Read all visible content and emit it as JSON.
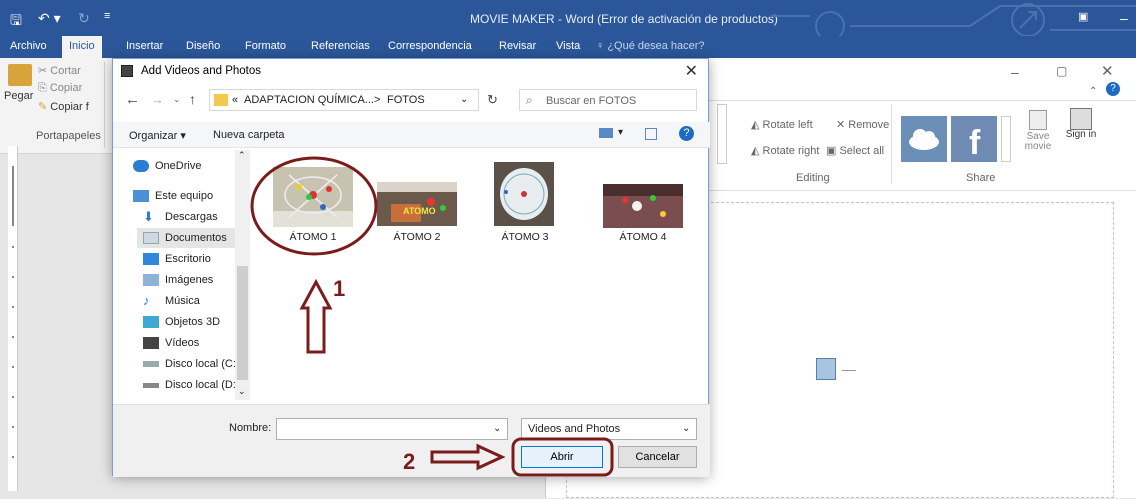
{
  "word": {
    "title": "MOVIE MAKER - Word (Error de activación de productos)",
    "tabs": [
      "Archivo",
      "Inicio",
      "Insertar",
      "Diseño",
      "Formato",
      "Referencias",
      "Correspondencia",
      "Revisar",
      "Vista"
    ],
    "tell_me": "¿Qué desea hacer?",
    "clipboard": {
      "paste": "Pegar",
      "cut": "Cortar",
      "copy": "Copiar",
      "format_copy": "Copiar f",
      "group": "Portapapeles"
    }
  },
  "movie_maker": {
    "rotate_left": "Rotate left",
    "rotate_right": "Rotate right",
    "remove": "Remove",
    "select_all": "Select all",
    "editing": "Editing",
    "save_movie": "Save movie",
    "sign_in": "Sign in",
    "share": "Share"
  },
  "dialog": {
    "title": "Add Videos and Photos",
    "path_prefix": "«",
    "path_part1": "ADAPTACION QUÍMICA...",
    "path_sep": ">",
    "path_part2": "FOTOS",
    "search_placeholder": "Buscar en FOTOS",
    "organize": "Organizar ▾",
    "new_folder": "Nueva carpeta",
    "nav": [
      "OneDrive",
      "Este equipo",
      "Descargas",
      "Documentos",
      "Escritorio",
      "Imágenes",
      "Música",
      "Objetos 3D",
      "Vídeos",
      "Disco local (C:)",
      "Disco local (D:)"
    ],
    "files": [
      "ÁTOMO 1",
      "ÁTOMO 2",
      "ÁTOMO 3",
      "ÁTOMO 4"
    ],
    "thumb_text_2": "ATOMO",
    "name_label": "Nombre:",
    "filetype": "Videos and Photos",
    "open": "Abrir",
    "cancel": "Cancelar"
  },
  "annotations": {
    "step1": "1",
    "step2": "2"
  },
  "colors": {
    "word_blue": "#2b579a",
    "annotation": "#7b1c1c",
    "selection": "#cce8ff"
  }
}
